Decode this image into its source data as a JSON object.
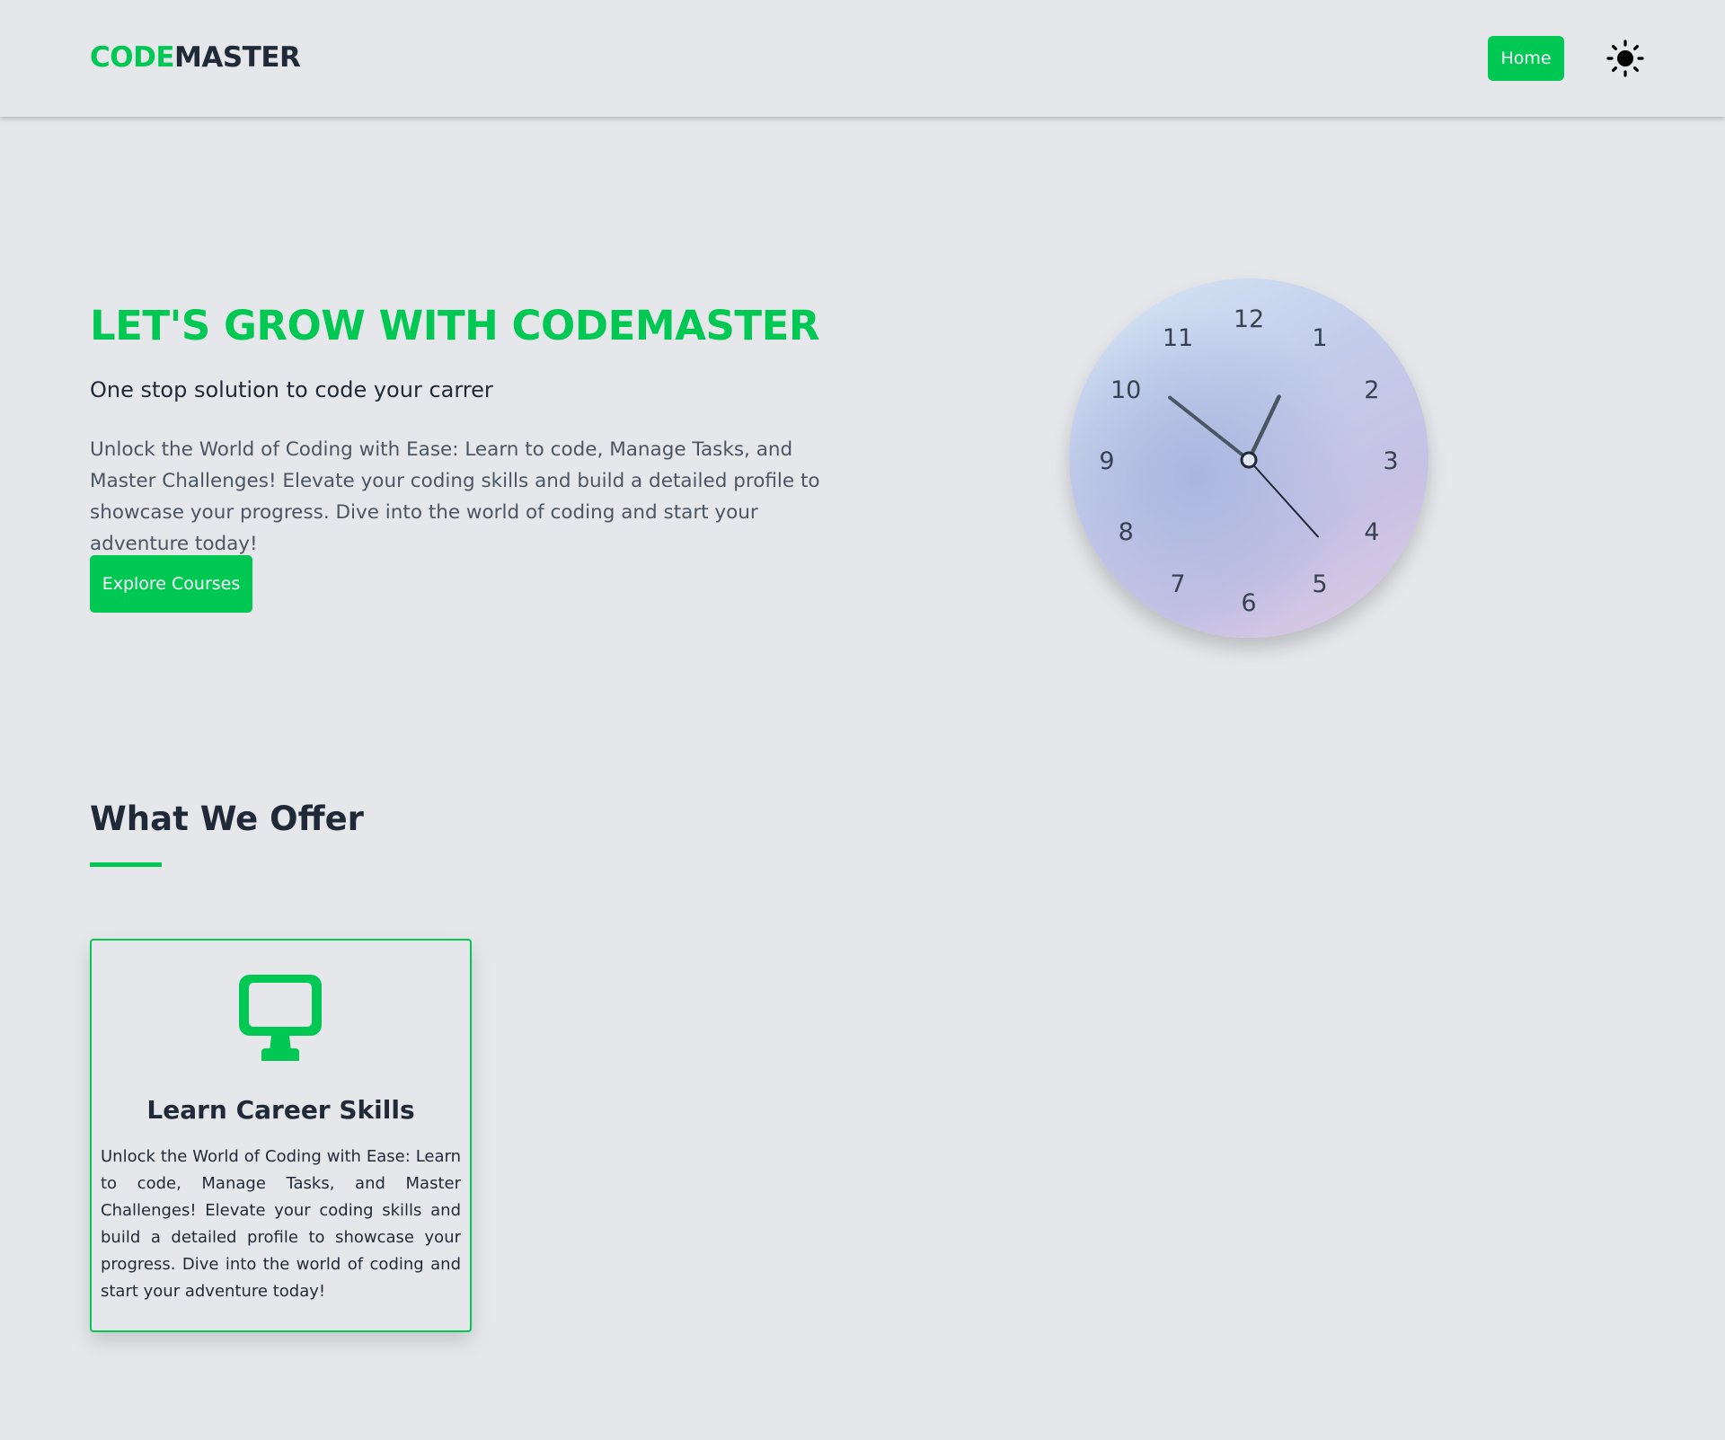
{
  "navbar": {
    "brand_accent": "CODE",
    "brand_main": "MASTER",
    "home_label": "Home",
    "theme_icon": "sun-icon"
  },
  "hero": {
    "title": "LET'S GROW WITH CODEMASTER",
    "subtitle": "One stop solution to code your carrer",
    "description": "Unlock the World of Coding with Ease: Learn to code, Manage Tasks, and Master Challenges! Elevate your coding skills and build a detailed profile to showcase your progress. Dive into the world of coding and start your adventure today!",
    "cta_label": "Explore Courses"
  },
  "clock": {
    "numerals": [
      "12",
      "1",
      "2",
      "3",
      "4",
      "5",
      "6",
      "7",
      "8",
      "9",
      "10",
      "11"
    ],
    "time": {
      "hour": 12,
      "minute": 51,
      "second": 23
    }
  },
  "offer": {
    "heading": "What We Offer",
    "cards": [
      {
        "icon": "monitor-icon",
        "title": "Learn Career Skills",
        "description": "Unlock the World of Coding with Ease: Learn to code, Manage Tasks, and Master Challenges! Elevate your coding skills and build a detailed profile to showcase your progress. Dive into the world of coding and start your adventure today!"
      }
    ]
  },
  "colors": {
    "accent": "#00c853",
    "background": "#e5e7eb",
    "text_dark": "#1f2937",
    "text_muted": "#4b5563"
  }
}
